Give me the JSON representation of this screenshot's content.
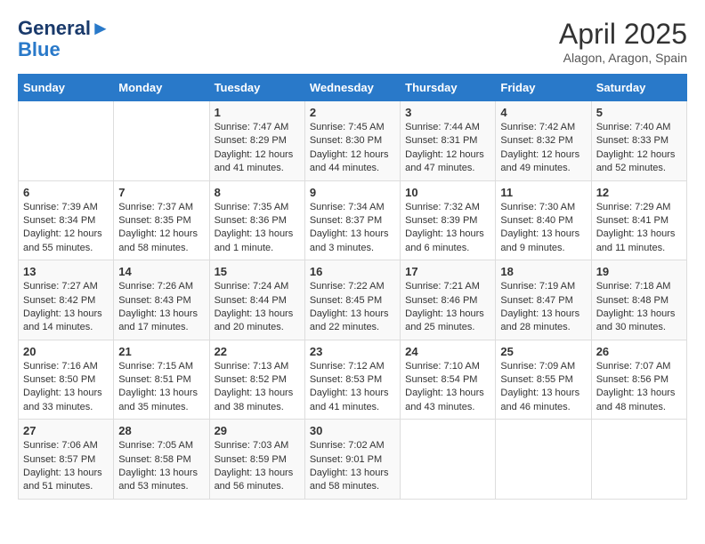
{
  "header": {
    "logo_line1": "General",
    "logo_line2": "Blue",
    "month_year": "April 2025",
    "location": "Alagon, Aragon, Spain"
  },
  "days_of_week": [
    "Sunday",
    "Monday",
    "Tuesday",
    "Wednesday",
    "Thursday",
    "Friday",
    "Saturday"
  ],
  "weeks": [
    [
      {
        "day": "",
        "content": ""
      },
      {
        "day": "",
        "content": ""
      },
      {
        "day": "1",
        "content": "Sunrise: 7:47 AM\nSunset: 8:29 PM\nDaylight: 12 hours and 41 minutes."
      },
      {
        "day": "2",
        "content": "Sunrise: 7:45 AM\nSunset: 8:30 PM\nDaylight: 12 hours and 44 minutes."
      },
      {
        "day": "3",
        "content": "Sunrise: 7:44 AM\nSunset: 8:31 PM\nDaylight: 12 hours and 47 minutes."
      },
      {
        "day": "4",
        "content": "Sunrise: 7:42 AM\nSunset: 8:32 PM\nDaylight: 12 hours and 49 minutes."
      },
      {
        "day": "5",
        "content": "Sunrise: 7:40 AM\nSunset: 8:33 PM\nDaylight: 12 hours and 52 minutes."
      }
    ],
    [
      {
        "day": "6",
        "content": "Sunrise: 7:39 AM\nSunset: 8:34 PM\nDaylight: 12 hours and 55 minutes."
      },
      {
        "day": "7",
        "content": "Sunrise: 7:37 AM\nSunset: 8:35 PM\nDaylight: 12 hours and 58 minutes."
      },
      {
        "day": "8",
        "content": "Sunrise: 7:35 AM\nSunset: 8:36 PM\nDaylight: 13 hours and 1 minute."
      },
      {
        "day": "9",
        "content": "Sunrise: 7:34 AM\nSunset: 8:37 PM\nDaylight: 13 hours and 3 minutes."
      },
      {
        "day": "10",
        "content": "Sunrise: 7:32 AM\nSunset: 8:39 PM\nDaylight: 13 hours and 6 minutes."
      },
      {
        "day": "11",
        "content": "Sunrise: 7:30 AM\nSunset: 8:40 PM\nDaylight: 13 hours and 9 minutes."
      },
      {
        "day": "12",
        "content": "Sunrise: 7:29 AM\nSunset: 8:41 PM\nDaylight: 13 hours and 11 minutes."
      }
    ],
    [
      {
        "day": "13",
        "content": "Sunrise: 7:27 AM\nSunset: 8:42 PM\nDaylight: 13 hours and 14 minutes."
      },
      {
        "day": "14",
        "content": "Sunrise: 7:26 AM\nSunset: 8:43 PM\nDaylight: 13 hours and 17 minutes."
      },
      {
        "day": "15",
        "content": "Sunrise: 7:24 AM\nSunset: 8:44 PM\nDaylight: 13 hours and 20 minutes."
      },
      {
        "day": "16",
        "content": "Sunrise: 7:22 AM\nSunset: 8:45 PM\nDaylight: 13 hours and 22 minutes."
      },
      {
        "day": "17",
        "content": "Sunrise: 7:21 AM\nSunset: 8:46 PM\nDaylight: 13 hours and 25 minutes."
      },
      {
        "day": "18",
        "content": "Sunrise: 7:19 AM\nSunset: 8:47 PM\nDaylight: 13 hours and 28 minutes."
      },
      {
        "day": "19",
        "content": "Sunrise: 7:18 AM\nSunset: 8:48 PM\nDaylight: 13 hours and 30 minutes."
      }
    ],
    [
      {
        "day": "20",
        "content": "Sunrise: 7:16 AM\nSunset: 8:50 PM\nDaylight: 13 hours and 33 minutes."
      },
      {
        "day": "21",
        "content": "Sunrise: 7:15 AM\nSunset: 8:51 PM\nDaylight: 13 hours and 35 minutes."
      },
      {
        "day": "22",
        "content": "Sunrise: 7:13 AM\nSunset: 8:52 PM\nDaylight: 13 hours and 38 minutes."
      },
      {
        "day": "23",
        "content": "Sunrise: 7:12 AM\nSunset: 8:53 PM\nDaylight: 13 hours and 41 minutes."
      },
      {
        "day": "24",
        "content": "Sunrise: 7:10 AM\nSunset: 8:54 PM\nDaylight: 13 hours and 43 minutes."
      },
      {
        "day": "25",
        "content": "Sunrise: 7:09 AM\nSunset: 8:55 PM\nDaylight: 13 hours and 46 minutes."
      },
      {
        "day": "26",
        "content": "Sunrise: 7:07 AM\nSunset: 8:56 PM\nDaylight: 13 hours and 48 minutes."
      }
    ],
    [
      {
        "day": "27",
        "content": "Sunrise: 7:06 AM\nSunset: 8:57 PM\nDaylight: 13 hours and 51 minutes."
      },
      {
        "day": "28",
        "content": "Sunrise: 7:05 AM\nSunset: 8:58 PM\nDaylight: 13 hours and 53 minutes."
      },
      {
        "day": "29",
        "content": "Sunrise: 7:03 AM\nSunset: 8:59 PM\nDaylight: 13 hours and 56 minutes."
      },
      {
        "day": "30",
        "content": "Sunrise: 7:02 AM\nSunset: 9:01 PM\nDaylight: 13 hours and 58 minutes."
      },
      {
        "day": "",
        "content": ""
      },
      {
        "day": "",
        "content": ""
      },
      {
        "day": "",
        "content": ""
      }
    ]
  ]
}
